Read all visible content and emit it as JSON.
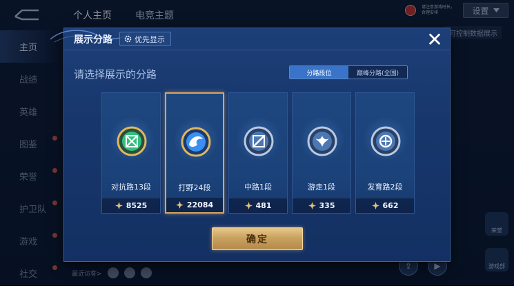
{
  "background": {
    "top_tabs": [
      "个人主页",
      "电竞主题"
    ],
    "notice_text": "请注意游戏时长，合理安排",
    "settings_label": "设置",
    "setting_hint": "可控制数据展示",
    "side_nav": [
      {
        "label": "主页",
        "active": true,
        "dot": false
      },
      {
        "label": "战绩",
        "active": false,
        "dot": false
      },
      {
        "label": "英雄",
        "active": false,
        "dot": false
      },
      {
        "label": "图鉴",
        "active": false,
        "dot": true
      },
      {
        "label": "荣誉",
        "active": false,
        "dot": true
      },
      {
        "label": "护卫队",
        "active": false,
        "dot": true
      },
      {
        "label": "游戏",
        "active": false,
        "dot": true
      },
      {
        "label": "社交",
        "active": false,
        "dot": true
      }
    ],
    "recent_visitors": "最近访客>",
    "widgets": [
      "荣誉",
      "游戏部"
    ]
  },
  "dialog": {
    "title": "展示分路",
    "priority_label": "优先显示",
    "close_symbol": "✕",
    "subtitle": "请选择展示的分路",
    "toggle": [
      {
        "label": "分路段位",
        "active": true
      },
      {
        "label": "巅峰分路(全国)",
        "active": false
      }
    ],
    "cards": [
      {
        "label": "对抗路13段",
        "score": "8525",
        "selected": false,
        "emblem": "green-shield",
        "color": "#31c17f"
      },
      {
        "label": "打野24段",
        "score": "22084",
        "selected": true,
        "emblem": "blue-dragon",
        "color": "#3a8ff0"
      },
      {
        "label": "中路1段",
        "score": "481",
        "selected": false,
        "emblem": "silver-slash",
        "color": "#8fb2d9"
      },
      {
        "label": "游走1段",
        "score": "335",
        "selected": false,
        "emblem": "silver-wing",
        "color": "#8fb2d9"
      },
      {
        "label": "发育路2段",
        "score": "662",
        "selected": false,
        "emblem": "silver-target",
        "color": "#8fb2d9"
      }
    ],
    "confirm_label": "确定"
  },
  "colors": {
    "accent_gold": "#d9a65b",
    "toggle_active": "#3a74c9",
    "dialog_bg": "#1b3d73"
  }
}
